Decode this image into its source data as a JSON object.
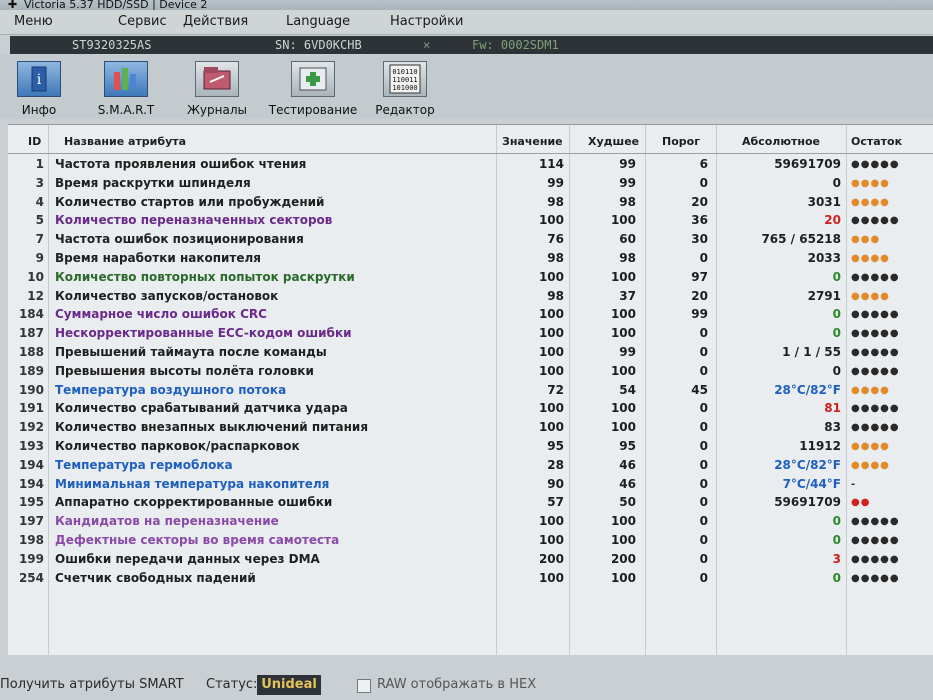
{
  "window": {
    "title": "Victoria 5.37 HDD/SSD | Device 2"
  },
  "menu": [
    "Меню",
    "Сервис",
    "Действия",
    "Language",
    "Настройки"
  ],
  "device": {
    "model": "ST9320325AS",
    "serial": "SN: 6VD0KCHB",
    "sep": "×",
    "firmware": "Fw: 0002SDM1"
  },
  "toolbar": [
    {
      "label": "Инфо",
      "icon": "info-icon",
      "active": true
    },
    {
      "label": "S.M.A.R.T",
      "icon": "smart-bars-icon",
      "active": true
    },
    {
      "label": "Журналы",
      "icon": "logs-icon",
      "active": false
    },
    {
      "label": "Тестирование",
      "icon": "test-icon",
      "active": false
    },
    {
      "label": "Редактор",
      "icon": "editor-binary-icon",
      "active": false
    }
  ],
  "table": {
    "headers": {
      "id": "ID",
      "name": "Название атрибута",
      "value": "Значение",
      "worst": "Худшее",
      "threshold": "Порог",
      "absolute": "Абсолютное",
      "remainder": "Остаток"
    },
    "rows": [
      {
        "id": "1",
        "name": "Частота проявления ошибок чтения",
        "value": "114",
        "worst": "99",
        "threshold": "6",
        "absolute": "59691709",
        "remainder": "●●●●●",
        "name_color": "#1f1f1f",
        "abs_color": "#1f1f1f",
        "rem_color": "#2a2a2a"
      },
      {
        "id": "3",
        "name": "Время раскрутки шпинделя",
        "value": "99",
        "worst": "99",
        "threshold": "0",
        "absolute": "0",
        "remainder": "●●●●",
        "name_color": "#1f1f1f",
        "abs_color": "#1f1f1f",
        "rem_color": "#e08a2a"
      },
      {
        "id": "4",
        "name": "Количество стартов или пробуждений",
        "value": "98",
        "worst": "98",
        "threshold": "20",
        "absolute": "3031",
        "remainder": "●●●●",
        "name_color": "#1f1f1f",
        "abs_color": "#1f1f1f",
        "rem_color": "#e08a2a"
      },
      {
        "id": "5",
        "name": "Количество переназначенных секторов",
        "value": "100",
        "worst": "100",
        "threshold": "36",
        "absolute": "20",
        "remainder": "●●●●●",
        "name_color": "#6a2a8a",
        "abs_color": "#d02020",
        "rem_color": "#2a2a2a"
      },
      {
        "id": "7",
        "name": "Частота ошибок позиционирования",
        "value": "76",
        "worst": "60",
        "threshold": "30",
        "absolute": "765 / 65218",
        "remainder": "●●●",
        "name_color": "#1f1f1f",
        "abs_color": "#1f1f1f",
        "rem_color": "#e08a2a"
      },
      {
        "id": "9",
        "name": "Время наработки накопителя",
        "value": "98",
        "worst": "98",
        "threshold": "0",
        "absolute": "2033",
        "remainder": "●●●●",
        "name_color": "#1f1f1f",
        "abs_color": "#1f1f1f",
        "rem_color": "#e08a2a"
      },
      {
        "id": "10",
        "name": "Количество повторных попыток раскрутки",
        "value": "100",
        "worst": "100",
        "threshold": "97",
        "absolute": "0",
        "remainder": "●●●●●",
        "name_color": "#2a6a2a",
        "abs_color": "#2a8a2a",
        "rem_color": "#2a2a2a"
      },
      {
        "id": "12",
        "name": "Количество запусков/остановок",
        "value": "98",
        "worst": "37",
        "threshold": "20",
        "absolute": "2791",
        "remainder": "●●●●",
        "name_color": "#1f1f1f",
        "abs_color": "#1f1f1f",
        "rem_color": "#e08a2a"
      },
      {
        "id": "184",
        "name": "Суммарное число ошибок CRC",
        "value": "100",
        "worst": "100",
        "threshold": "99",
        "absolute": "0",
        "remainder": "●●●●●",
        "name_color": "#6a2a8a",
        "abs_color": "#2a8a2a",
        "rem_color": "#2a2a2a"
      },
      {
        "id": "187",
        "name": "Нескорректированные ECC-кодом ошибки",
        "value": "100",
        "worst": "100",
        "threshold": "0",
        "absolute": "0",
        "remainder": "●●●●●",
        "name_color": "#6a2a8a",
        "abs_color": "#2a8a2a",
        "rem_color": "#2a2a2a"
      },
      {
        "id": "188",
        "name": "Превышений таймаута после команды",
        "value": "100",
        "worst": "99",
        "threshold": "0",
        "absolute": "1 / 1 / 55",
        "remainder": "●●●●●",
        "name_color": "#1f1f1f",
        "abs_color": "#1f1f1f",
        "rem_color": "#2a2a2a"
      },
      {
        "id": "189",
        "name": "Превышения высоты полёта головки",
        "value": "100",
        "worst": "100",
        "threshold": "0",
        "absolute": "0",
        "remainder": "●●●●●",
        "name_color": "#1f1f1f",
        "abs_color": "#1f1f1f",
        "rem_color": "#2a2a2a"
      },
      {
        "id": "190",
        "name": "Температура воздушного потока",
        "value": "72",
        "worst": "54",
        "threshold": "45",
        "absolute": "28°C/82°F",
        "remainder": "●●●●",
        "name_color": "#1f5fbf",
        "abs_color": "#1f5fbf",
        "rem_color": "#e08a2a"
      },
      {
        "id": "191",
        "name": "Количество срабатываний датчика удара",
        "value": "100",
        "worst": "100",
        "threshold": "0",
        "absolute": "81",
        "remainder": "●●●●●",
        "name_color": "#1f1f1f",
        "abs_color": "#d02020",
        "rem_color": "#2a2a2a"
      },
      {
        "id": "192",
        "name": "Количество внезапных выключений питания",
        "value": "100",
        "worst": "100",
        "threshold": "0",
        "absolute": "83",
        "remainder": "●●●●●",
        "name_color": "#1f1f1f",
        "abs_color": "#1f1f1f",
        "rem_color": "#2a2a2a"
      },
      {
        "id": "193",
        "name": "Количество парковок/распарковок",
        "value": "95",
        "worst": "95",
        "threshold": "0",
        "absolute": "11912",
        "remainder": "●●●●",
        "name_color": "#1f1f1f",
        "abs_color": "#1f1f1f",
        "rem_color": "#e08a2a"
      },
      {
        "id": "194",
        "name": "Температура гермоблока",
        "value": "28",
        "worst": "46",
        "threshold": "0",
        "absolute": "28°C/82°F",
        "remainder": "●●●●",
        "name_color": "#1f5fbf",
        "abs_color": "#1f5fbf",
        "rem_color": "#e08a2a"
      },
      {
        "id": "194",
        "name": "Минимальная температура накопителя",
        "value": "90",
        "worst": "46",
        "threshold": "0",
        "absolute": "7°C/44°F",
        "remainder": "-",
        "name_color": "#1f5fbf",
        "abs_color": "#1f5fbf",
        "rem_color": "#2a2a2a"
      },
      {
        "id": "195",
        "name": "Аппаратно скорректированные ошибки",
        "value": "57",
        "worst": "50",
        "threshold": "0",
        "absolute": "59691709",
        "remainder": "●●",
        "name_color": "#1f1f1f",
        "abs_color": "#1f1f1f",
        "rem_color": "#d02020"
      },
      {
        "id": "197",
        "name": "Кандидатов на переназначение",
        "value": "100",
        "worst": "100",
        "threshold": "0",
        "absolute": "0",
        "remainder": "●●●●●",
        "name_color": "#8a4aa8",
        "abs_color": "#2a8a2a",
        "rem_color": "#2a2a2a"
      },
      {
        "id": "198",
        "name": "Дефектные секторы во время самотеста",
        "value": "100",
        "worst": "100",
        "threshold": "0",
        "absolute": "0",
        "remainder": "●●●●●",
        "name_color": "#8a4aa8",
        "abs_color": "#2a8a2a",
        "rem_color": "#2a2a2a"
      },
      {
        "id": "199",
        "name": "Ошибки передачи данных через DMA",
        "value": "200",
        "worst": "200",
        "threshold": "0",
        "absolute": "3",
        "remainder": "●●●●●",
        "name_color": "#1f1f1f",
        "abs_color": "#d02020",
        "rem_color": "#2a2a2a"
      },
      {
        "id": "254",
        "name": "Счетчик свободных падений",
        "value": "100",
        "worst": "100",
        "threshold": "0",
        "absolute": "0",
        "remainder": "●●●●●",
        "name_color": "#1f1f1f",
        "abs_color": "#2a8a2a",
        "rem_color": "#2a2a2a"
      }
    ]
  },
  "statusbar": {
    "get_smart": "Получить атрибуты SMART",
    "status_label": "Статус:",
    "status_value": "Unideal",
    "raw_hex": "RAW отображать в HEX"
  },
  "colors": {
    "device_bar_bg": "#2e3338",
    "status_value": "#e6c35c",
    "good": "#2a8a2a",
    "bad": "#d02020",
    "warn": "#e08a2a",
    "temp": "#1f5fbf"
  }
}
